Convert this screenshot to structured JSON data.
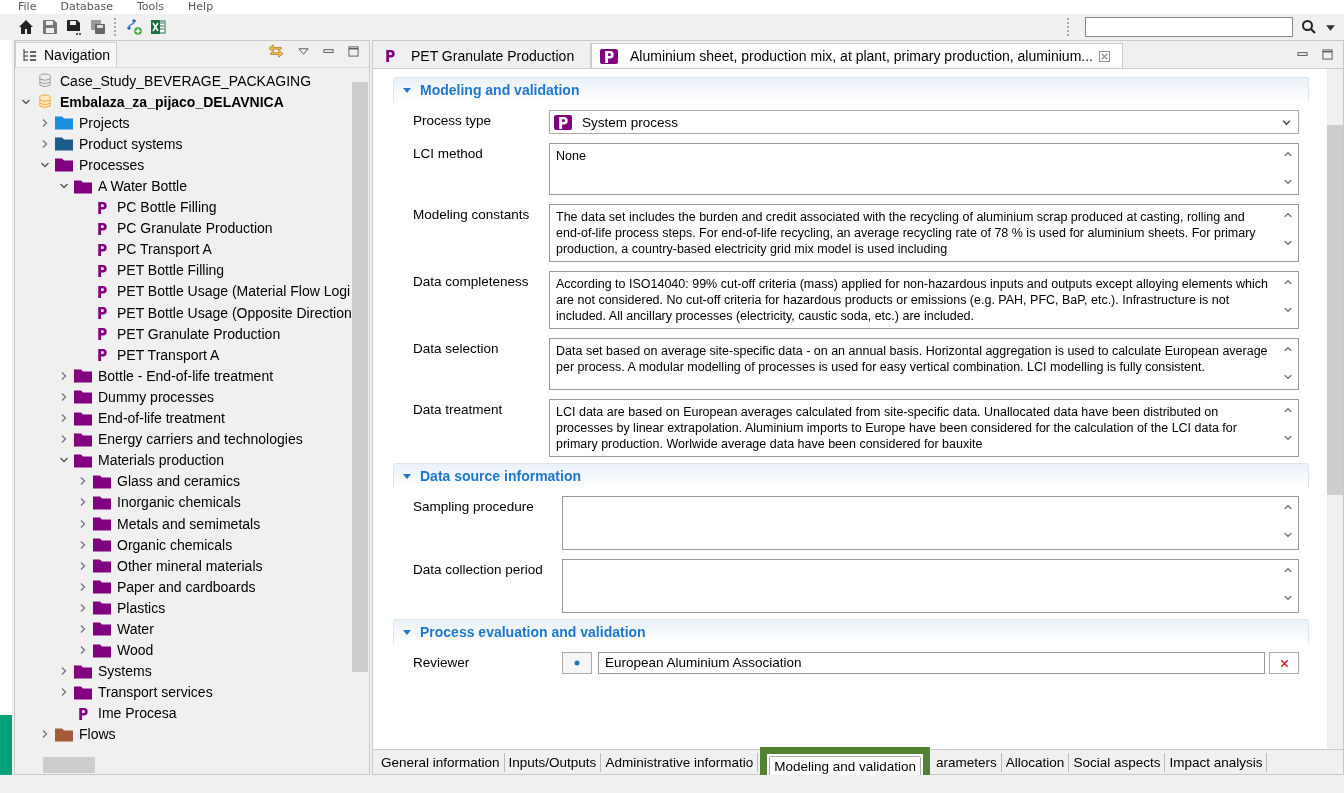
{
  "menu": [
    "File",
    "Database",
    "Tools",
    "Help"
  ],
  "navigation": {
    "title": "Navigation",
    "tree": [
      {
        "kind": "database",
        "label": "Case_Study_BEVERAGE_PACKAGING",
        "active": false
      },
      {
        "kind": "database",
        "label": "Embalaza_za_pijaco_DELAVNICA",
        "active": true,
        "expanded": true,
        "children": [
          {
            "kind": "folder",
            "label": "Projects",
            "color": "#1a8fe0",
            "expanded": false
          },
          {
            "kind": "folder",
            "label": "Product systems",
            "color": "#1a5c8a",
            "expanded": false
          },
          {
            "kind": "folder",
            "label": "Processes",
            "color": "#800080",
            "expanded": true,
            "children": [
              {
                "kind": "folder",
                "label": "A Water Bottle",
                "color": "#800080",
                "expanded": true,
                "children": [
                  {
                    "kind": "process",
                    "label": "PC Bottle Filling"
                  },
                  {
                    "kind": "process",
                    "label": "PC Granulate Production"
                  },
                  {
                    "kind": "process",
                    "label": "PC Transport A"
                  },
                  {
                    "kind": "process",
                    "label": "PET Bottle Filling"
                  },
                  {
                    "kind": "process",
                    "label": "PET Bottle Usage (Material Flow Logi"
                  },
                  {
                    "kind": "process",
                    "label": "PET Bottle Usage (Opposite Direction"
                  },
                  {
                    "kind": "process",
                    "label": "PET Granulate Production"
                  },
                  {
                    "kind": "process",
                    "label": "PET Transport A"
                  }
                ]
              },
              {
                "kind": "folder",
                "label": "Bottle - End-of-life treatment",
                "color": "#800080",
                "expanded": false
              },
              {
                "kind": "folder",
                "label": "Dummy processes",
                "color": "#800080",
                "expanded": false
              },
              {
                "kind": "folder",
                "label": "End-of-life treatment",
                "color": "#800080",
                "expanded": false
              },
              {
                "kind": "folder",
                "label": "Energy carriers and technologies",
                "color": "#800080",
                "expanded": false
              },
              {
                "kind": "folder",
                "label": "Materials production",
                "color": "#800080",
                "expanded": true,
                "children": [
                  {
                    "kind": "folder",
                    "label": "Glass and ceramics",
                    "color": "#800080",
                    "expanded": false
                  },
                  {
                    "kind": "folder",
                    "label": "Inorganic chemicals",
                    "color": "#800080",
                    "expanded": false
                  },
                  {
                    "kind": "folder",
                    "label": "Metals and semimetals",
                    "color": "#800080",
                    "expanded": false
                  },
                  {
                    "kind": "folder",
                    "label": "Organic chemicals",
                    "color": "#800080",
                    "expanded": false
                  },
                  {
                    "kind": "folder",
                    "label": "Other mineral materials",
                    "color": "#800080",
                    "expanded": false
                  },
                  {
                    "kind": "folder",
                    "label": "Paper and cardboards",
                    "color": "#800080",
                    "expanded": false
                  },
                  {
                    "kind": "folder",
                    "label": "Plastics",
                    "color": "#800080",
                    "expanded": false
                  },
                  {
                    "kind": "folder",
                    "label": "Water",
                    "color": "#800080",
                    "expanded": false
                  },
                  {
                    "kind": "folder",
                    "label": "Wood",
                    "color": "#800080",
                    "expanded": false
                  }
                ]
              },
              {
                "kind": "folder",
                "label": "Systems",
                "color": "#800080",
                "expanded": false
              },
              {
                "kind": "folder",
                "label": "Transport services",
                "color": "#800080",
                "expanded": false
              },
              {
                "kind": "process",
                "label": "Ime Procesa"
              }
            ]
          },
          {
            "kind": "folder",
            "label": "Flows",
            "color": "#a65a3c",
            "expanded": false
          }
        ]
      }
    ]
  },
  "editor": {
    "tabs": [
      {
        "label": "PET Granulate Production",
        "selected": false
      },
      {
        "label": "Aluminium sheet, production mix, at plant, primary production, aluminium...",
        "selected": true
      }
    ],
    "sections": [
      {
        "title": "Modeling and validation",
        "expanded": true,
        "fields": [
          {
            "kind": "combo",
            "label": "Process type",
            "value": "System process"
          },
          {
            "kind": "text",
            "label": "LCI method",
            "value": "None"
          },
          {
            "kind": "text",
            "label": "Modeling constants",
            "value": "The data set includes the burden and credit associated with the recycling of aluminium scrap produced at casting, rolling and end-of-life process steps. For end-of-life recycling, an average recycling rate of 78 % is used for aluminium sheets. For primary production, a country-based electricity grid mix model is used including"
          },
          {
            "kind": "text",
            "label": "Data completeness",
            "value": "According to ISO14040: 99% cut-off criteria (mass) applied for non-hazardous inputs and outputs except alloying elements which are not considered. No cut-off criteria for hazardous products or emissions (e.g. PAH, PFC, BaP, etc.). Infrastructure is not included. All ancillary processes (electricity, caustic soda, etc.) are included."
          },
          {
            "kind": "text",
            "label": "Data selection",
            "value": "Data set based on average site-specific data - on an annual basis. Horizontal aggregation is used to calculate European average per process. A modular modelling of processes is used for easy vertical combination. LCI modelling is fully consistent."
          },
          {
            "kind": "text",
            "label": "Data treatment",
            "value": "LCI data are based on European averages calculated from site-specific data. Unallocated data have been distributed on processes by linear extrapolation. Aluminium imports to Europe have been considered for the calculation of the LCI data for primary production. Worlwide average data have been considered for bauxite"
          }
        ]
      },
      {
        "title": "Data source information",
        "expanded": true,
        "fields": [
          {
            "kind": "text",
            "label": "Sampling procedure"
          },
          {
            "kind": "text",
            "label": "Data collection period"
          }
        ]
      },
      {
        "title": "Process evaluation and validation",
        "expanded": true,
        "fields": [
          {
            "kind": "reviewer",
            "label": "Reviewer",
            "value": "European Aluminium Association"
          }
        ]
      }
    ],
    "page_tabs": [
      {
        "label": "General information",
        "selected": false,
        "highlighted": false
      },
      {
        "label": "Inputs/Outputs",
        "selected": false,
        "highlighted": false
      },
      {
        "label": "Administrative informatio",
        "selected": false,
        "highlighted": false
      },
      {
        "label": "Modeling and validation",
        "selected": true,
        "highlighted": true
      },
      {
        "label": "arameters",
        "selected": false,
        "highlighted": false
      },
      {
        "label": "Allocation",
        "selected": false,
        "highlighted": false
      },
      {
        "label": "Social aspects",
        "selected": false,
        "highlighted": false
      },
      {
        "label": "Impact analysis",
        "selected": false,
        "highlighted": false
      }
    ]
  }
}
